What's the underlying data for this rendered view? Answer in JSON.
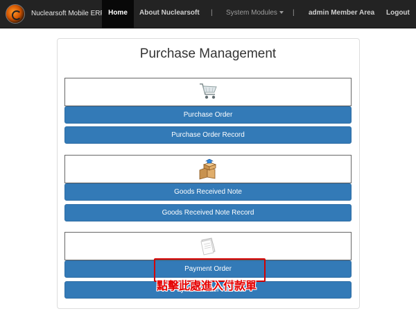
{
  "navbar": {
    "brand": "Nuclearsoft Mobile ERP",
    "home": "Home",
    "about": "About Nuclearsoft",
    "separator": "|",
    "system_modules": "System Modules",
    "admin": "admin Member Area",
    "logout": "Logout"
  },
  "page": {
    "title": "Purchase Management"
  },
  "sections": [
    {
      "icon": "shopping-cart-icon",
      "buttons": [
        "Purchase Order",
        "Purchase Order Record"
      ]
    },
    {
      "icon": "boxes-icon",
      "buttons": [
        "Goods Received Note",
        "Goods Received Note Record"
      ]
    },
    {
      "icon": "document-icon",
      "buttons": [
        "Payment Order",
        "Payment Order Record"
      ]
    }
  ],
  "annotation": {
    "text": "點擊此處進入付款單",
    "color": "#e40000"
  },
  "colors": {
    "navbar_bg": "#232323",
    "button_blue": "#337ab7",
    "highlight_red": "#d40000"
  }
}
